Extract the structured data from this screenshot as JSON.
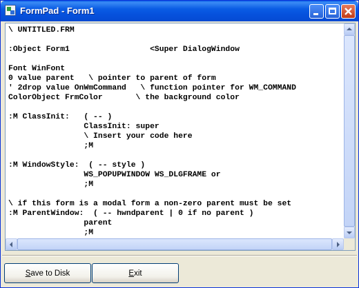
{
  "window": {
    "title": "FormPad - Form1",
    "app_icon": "formpad-app-icon",
    "controls": {
      "minimize_icon": "minimize-icon",
      "maximize_icon": "maximize-icon",
      "close_icon": "close-icon"
    }
  },
  "editor": {
    "lines": [
      "\\ UNTITLED.FRM",
      "",
      ":Object Form1                 <Super DialogWindow",
      "",
      "Font WinFont",
      "0 value parent   \\ pointer to parent of form",
      "' 2drop value OnWmCommand   \\ function pointer for WM_COMMAND",
      "ColorObject FrmColor       \\ the background color",
      "",
      ":M ClassInit:   ( -- )",
      "                ClassInit: super",
      "                \\ Insert your code here",
      "                ;M",
      "",
      ":M WindowStyle:  ( -- style )",
      "                WS_POPUPWINDOW WS_DLGFRAME or",
      "                ;M",
      "",
      "\\ if this form is a modal form a non-zero parent must be set",
      ":M ParentWindow:  ( -- hwndparent | 0 if no parent )",
      "                parent",
      "                ;M"
    ]
  },
  "scrollbars": {
    "vertical": {
      "up_icon": "scroll-up-arrow-icon",
      "down_icon": "scroll-down-arrow-icon"
    },
    "horizontal": {
      "left_icon": "scroll-left-arrow-icon",
      "right_icon": "scroll-right-arrow-icon"
    }
  },
  "buttons": {
    "save_label": "Save to Disk",
    "exit_label": "Exit"
  }
}
